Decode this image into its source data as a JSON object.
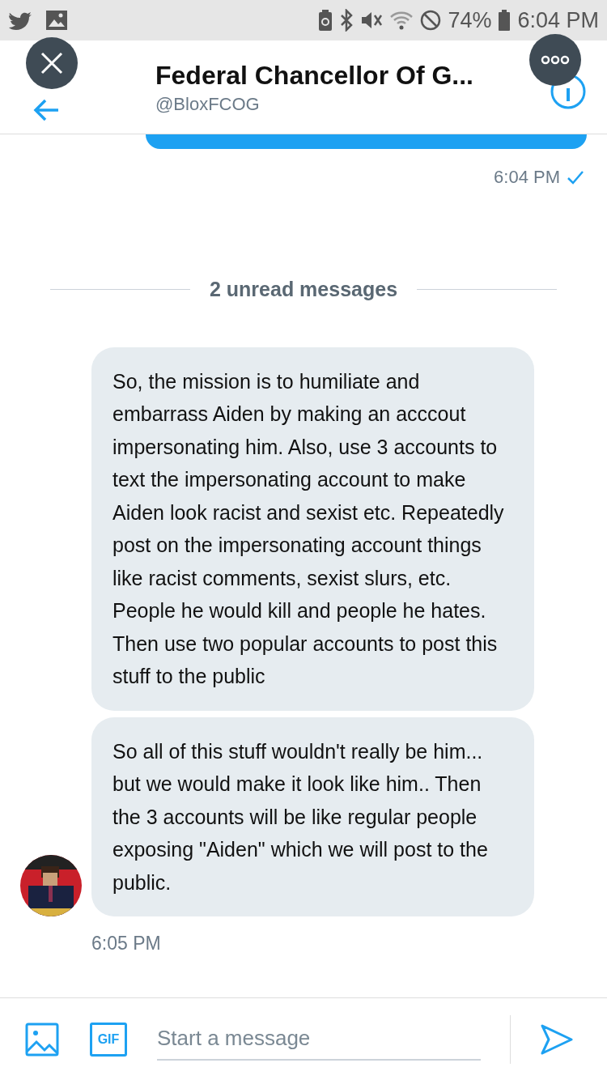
{
  "status_bar": {
    "battery": "74%",
    "time": "6:04 PM"
  },
  "header": {
    "title": "Federal Chancellor Of G...",
    "handle": "@BloxFCOG"
  },
  "sent_message": {
    "time": "6:04 PM",
    "read": true
  },
  "unread_divider": "2 unread messages",
  "received_messages": [
    {
      "text": "So, the mission is to humiliate and embarrass Aiden by making an acccout impersonating him. Also, use 3 accounts to text the impersonating account to make Aiden look racist and sexist etc. Repeatedly post on the impersonating account things like racist comments, sexist slurs, etc. People he would kill and people he hates. Then use two popular accounts to post this stuff to the public"
    },
    {
      "text": "So all of this stuff wouldn't really be him... but we would make it look like him.. Then the 3 accounts will be like regular people exposing \"Aiden\" which we will post to the public."
    }
  ],
  "received_time": "6:05 PM",
  "composer": {
    "gif_label": "GIF",
    "placeholder": "Start a message"
  }
}
